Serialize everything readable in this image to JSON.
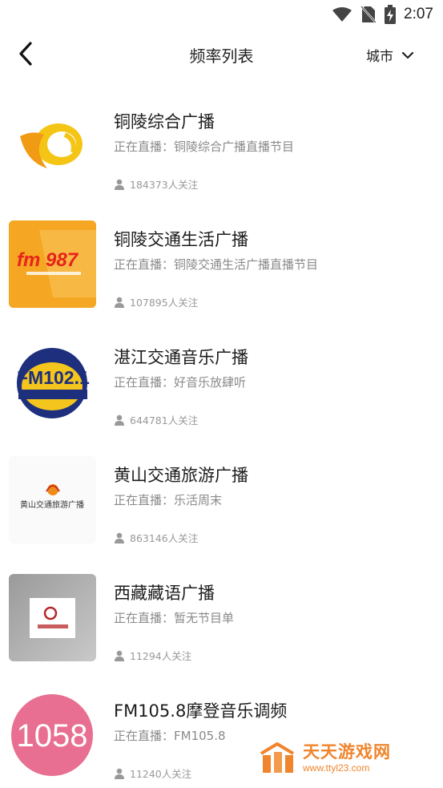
{
  "status_bar": {
    "time": "2:07"
  },
  "header": {
    "title": "频率列表",
    "city_label": "城市"
  },
  "stations": [
    {
      "name": "铜陵综合广播",
      "live": "正在直播：铜陵综合广播直播节目",
      "followers": "184373人关注",
      "logo": "tongling-logo"
    },
    {
      "name": "铜陵交通生活广播",
      "live": "正在直播：铜陵交通生活广播直播节目",
      "followers": "107895人关注",
      "logo": "fm987-logo",
      "logo_text": "fm 987"
    },
    {
      "name": "湛江交通音乐广播",
      "live": "正在直播：好音乐放肆听",
      "followers": "644781人关注",
      "logo": "fm1021-logo",
      "logo_text": "FM102.1"
    },
    {
      "name": "黄山交通旅游广播",
      "live": "正在直播：乐活周末",
      "followers": "863146人关注",
      "logo": "huangshan-logo",
      "logo_text": "黄山交通旅游广播"
    },
    {
      "name": "西藏藏语广播",
      "live": "正在直播：暂无节目单",
      "followers": "11294人关注",
      "logo": "xizang-logo"
    },
    {
      "name": "FM105.8摩登音乐调频",
      "live": "正在直播：FM105.8",
      "followers": "11240人关注",
      "logo": "fm1058-logo",
      "logo_text": "1058"
    }
  ],
  "watermark": {
    "title": "天天游戏网",
    "url": "www.ttyl23.com"
  },
  "colors": {
    "orange": "#f0852d",
    "pink": "#e86f91",
    "navy": "#1d2f7d",
    "yellow": "#f4c51c"
  }
}
